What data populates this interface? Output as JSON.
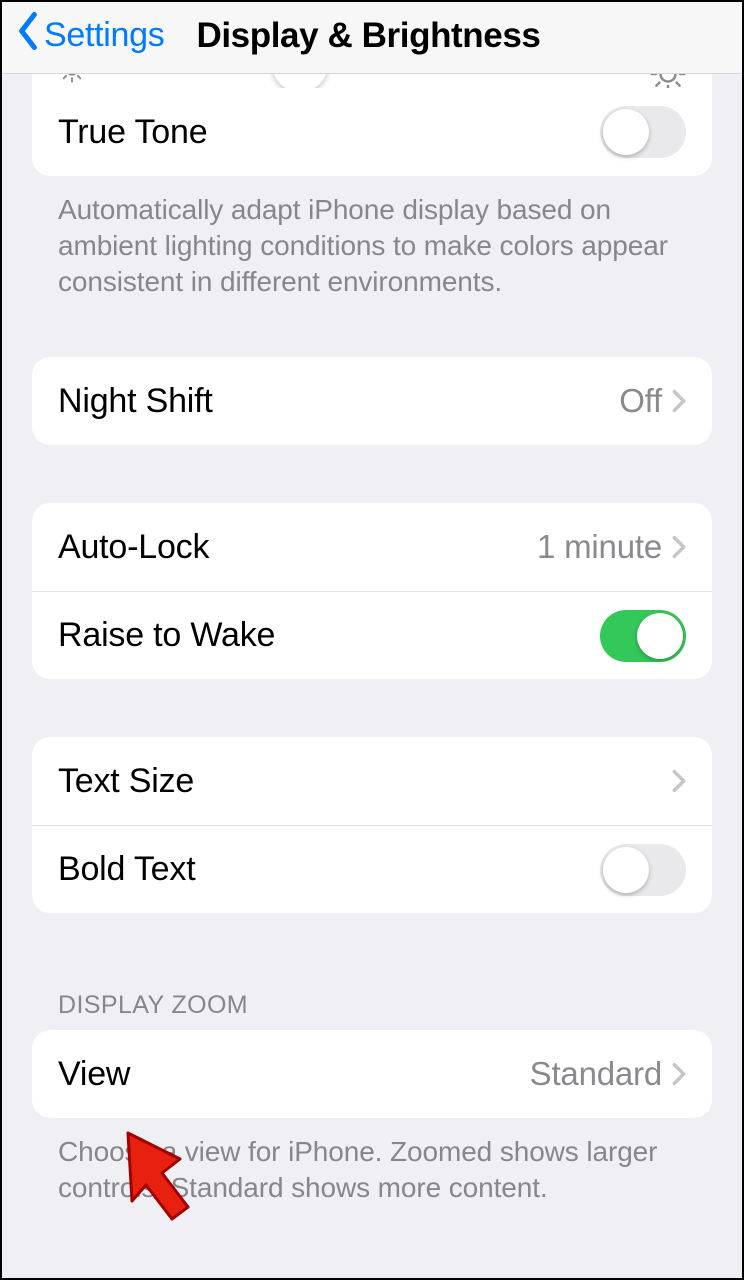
{
  "nav": {
    "back_label": "Settings",
    "title": "Display & Brightness"
  },
  "true_tone": {
    "label": "True Tone",
    "footer": "Automatically adapt iPhone display based on ambient lighting conditions to make colors appear consistent in different environments."
  },
  "night_shift": {
    "label": "Night Shift",
    "value": "Off"
  },
  "auto_lock": {
    "label": "Auto-Lock",
    "value": "1 minute"
  },
  "raise_to_wake": {
    "label": "Raise to Wake"
  },
  "text_size": {
    "label": "Text Size"
  },
  "bold_text": {
    "label": "Bold Text"
  },
  "display_zoom": {
    "header": "DISPLAY ZOOM",
    "view_label": "View",
    "view_value": "Standard",
    "footer": "Choose a view for iPhone. Zoomed shows larger controls. Standard shows more content."
  }
}
